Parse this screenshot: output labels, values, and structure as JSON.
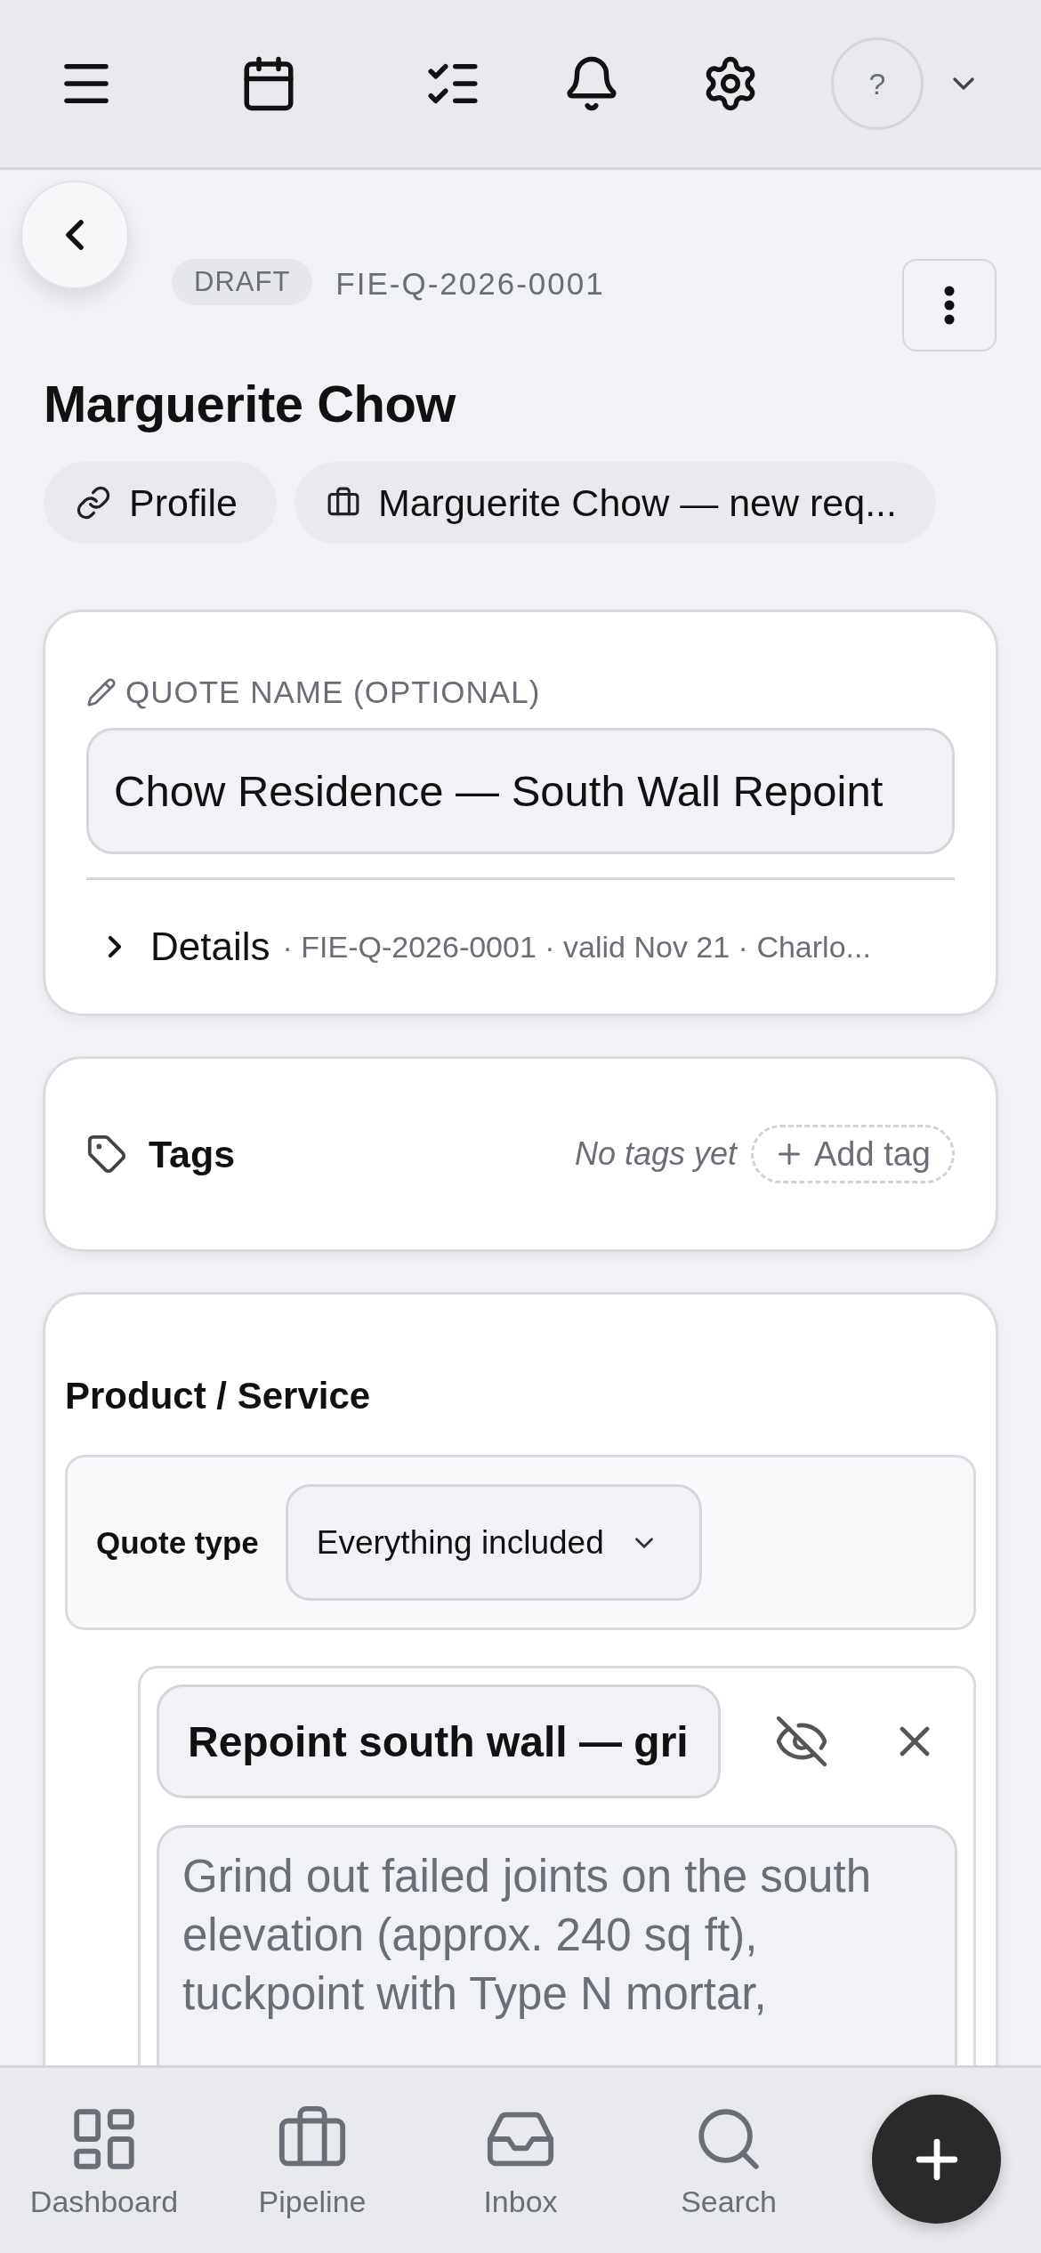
{
  "top_bar": {
    "avatar": "?"
  },
  "header": {
    "status": "DRAFT",
    "quote_id": "FIE-Q-2026-0001",
    "title": "Marguerite Chow",
    "chips": [
      {
        "kind": "link",
        "label": "Profile"
      },
      {
        "kind": "deal",
        "label": "Marguerite Chow — new req..."
      }
    ]
  },
  "quote_card": {
    "label": "QUOTE NAME (OPTIONAL)",
    "value": "Chow Residence — South Wall Repoint",
    "details": {
      "label": "Details",
      "expanded": false,
      "summary": "· FIE-Q-2026-0001 · valid Nov 21 · Charlo..."
    }
  },
  "tags_card": {
    "label": "Tags",
    "empty_text": "No tags yet",
    "add_button": "Add tag"
  },
  "product_card": {
    "heading": "Product / Service",
    "quote_type": {
      "label": "Quote type",
      "value": "Everything included"
    },
    "line_item": {
      "title": "Repoint south wall — gri",
      "hidden": true,
      "description": "Grind out failed joints on the south elevation (approx. 240 sq ft), tuckpoint with Type N mortar,"
    }
  },
  "bottom_nav": [
    {
      "kind": "dashboard",
      "label": "Dashboard",
      "selected": false
    },
    {
      "kind": "pipeline",
      "label": "Pipeline",
      "selected": false
    },
    {
      "kind": "inbox",
      "label": "Inbox",
      "selected": false
    },
    {
      "kind": "search",
      "label": "Search",
      "selected": false
    }
  ]
}
